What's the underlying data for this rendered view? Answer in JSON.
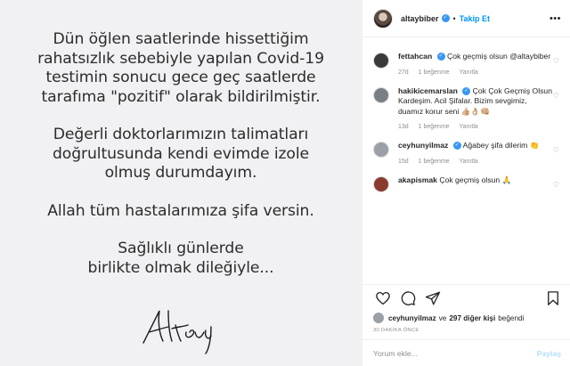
{
  "post": {
    "paragraphs": [
      "Dün öğlen saatlerinde hissettiğim\nrahatsızlık sebebiyle yapılan Covid-19\ntestimin  sonucu gece geç saatlerde\ntarafıma \"pozitif\" olarak bildirilmiştir.",
      "Değerli doktorlarımızın talimatları\ndoğrultusunda kendi evimde izole\nolmuş durumdayım.",
      "Allah tüm hastalarımıza şifa versin.",
      "Sağlıklı günlerde\nbirlikte olmak dileğiyle..."
    ],
    "signature_text": "Altay"
  },
  "header": {
    "username": "altaybiber",
    "verified_mark": "✓",
    "separator": "•",
    "follow_label": "Takip Et",
    "more_icon": "more-horizontal-icon"
  },
  "comments": [
    {
      "user": "fettahcan",
      "verified": true,
      "text": "Çok geçmiş olsun @altaybiber",
      "age": "27d",
      "likes": "1 beğenme",
      "reply": "Yanıtla",
      "avatar_color": "#3a3a3a"
    },
    {
      "user": "hakikicemarslan",
      "verified": true,
      "text": "Çok Çok Geçmiş Olsun Kardeşim. Acil Şifalar. Bizim sevgimiz, duamız korur seni 👍🏼👌🏼👊🏼",
      "age": "13d",
      "likes": "1 beğenme",
      "reply": "Yanıtla",
      "avatar_color": "#7a7f86"
    },
    {
      "user": "ceyhunyilmaz",
      "verified": true,
      "text": "Ağabey şifa dilerim 👏",
      "age": "15d",
      "likes": "1 beğenme",
      "reply": "Yanıtla",
      "avatar_color": "#9aa0a6"
    },
    {
      "user": "akapismak",
      "verified": false,
      "text": "Çok geçmiş olsun 🙏",
      "age": "",
      "likes": "",
      "reply": "",
      "avatar_color": "#8a3b2e"
    }
  ],
  "likes": {
    "user": "ceyhunyilmaz",
    "connector": "ve",
    "others": "297 diğer kişi",
    "suffix": "beğendi"
  },
  "time_label": "30 DAKİKA ÖNCE",
  "comment_input": {
    "placeholder": "Yorum ekle...",
    "post_label": "Paylaş"
  },
  "colors": {
    "accent": "#0095f6",
    "verified": "#3897f0",
    "muted": "#8e8e8e",
    "image_bg": "#f1f1f3"
  }
}
